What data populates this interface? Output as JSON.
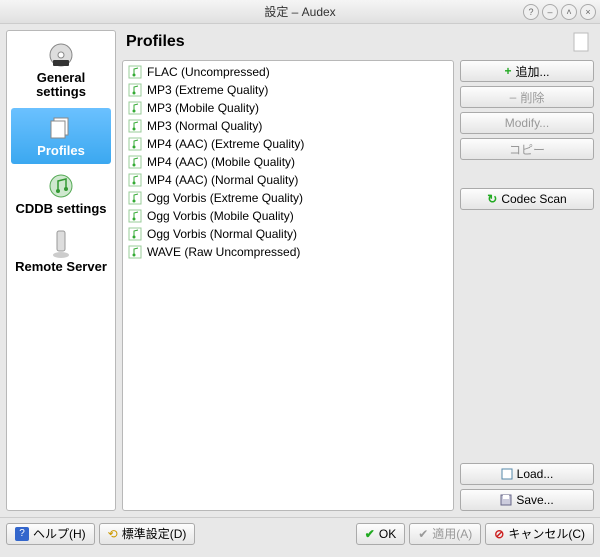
{
  "window": {
    "title": "設定 – Audex"
  },
  "sidebar": {
    "items": [
      {
        "label": "General settings"
      },
      {
        "label": "Profiles"
      },
      {
        "label": "CDDB settings"
      },
      {
        "label": "Remote Server"
      }
    ]
  },
  "content": {
    "heading": "Profiles"
  },
  "profiles": [
    "FLAC (Uncompressed)",
    "MP3 (Extreme Quality)",
    "MP3 (Mobile Quality)",
    "MP3 (Normal Quality)",
    "MP4 (AAC) (Extreme Quality)",
    "MP4 (AAC) (Mobile Quality)",
    "MP4 (AAC) (Normal Quality)",
    "Ogg Vorbis (Extreme Quality)",
    "Ogg Vorbis (Mobile Quality)",
    "Ogg Vorbis (Normal Quality)",
    "WAVE (Raw Uncompressed)"
  ],
  "buttons": {
    "add": "追加...",
    "delete": "削除",
    "modify": "Modify...",
    "copy": "コピー",
    "codecscan": "Codec Scan",
    "load": "Load...",
    "save": "Save...",
    "help": "ヘルプ(H)",
    "defaults": "標準設定(D)",
    "ok": "OK",
    "apply": "適用(A)",
    "cancel": "キャンセル(C)"
  }
}
